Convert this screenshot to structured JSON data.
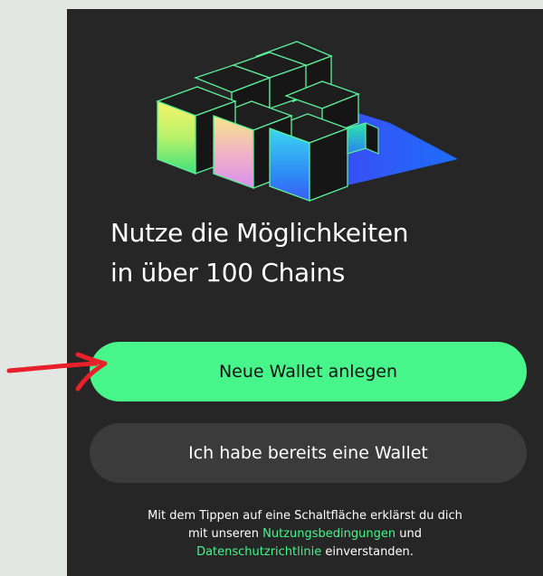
{
  "onboarding": {
    "headline_line1": "Nutze die Möglichkeiten",
    "headline_line2": "in über 100 Chains",
    "primary_button_label": "Neue Wallet anlegen",
    "secondary_button_label": "Ich habe bereits eine Wallet",
    "legal": {
      "line1": "Mit dem Tippen auf eine Schaltfläche erklärst du dich",
      "line2_prefix": "mit unseren ",
      "terms_link": "Nutzungsbedingungen",
      "line2_suffix": " und",
      "privacy_link": "Datenschutzrichtlinie",
      "line3_suffix": " einverstanden."
    }
  },
  "colors": {
    "background": "#262626",
    "accent": "#47f58a",
    "secondary_button": "#3b3b3b",
    "annotation_arrow": "#e8202a"
  },
  "icons": {
    "hero": "stacked-cubes-illustration",
    "annotation": "red-arrow-icon"
  }
}
